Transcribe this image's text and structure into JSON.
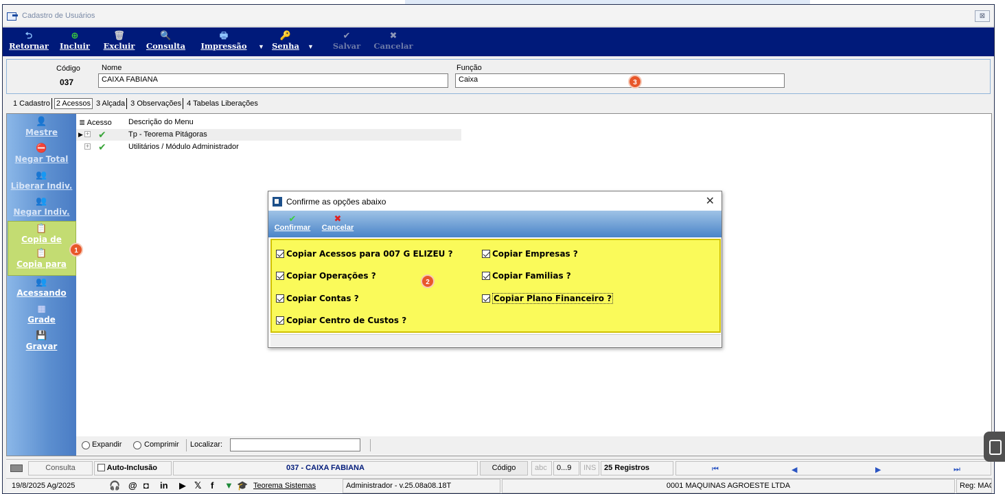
{
  "window": {
    "title": "Cadastro de Usuários",
    "close_glyph": "⊠"
  },
  "toolbar": {
    "items": [
      {
        "label": "Retornar",
        "icon": "return-icon",
        "glyph": "⮌",
        "color": "#8fc4ff"
      },
      {
        "label": "Incluir",
        "icon": "add-icon",
        "glyph": "⊕",
        "color": "#3bd13b"
      },
      {
        "label": "Excluir",
        "icon": "trash-icon",
        "glyph": "🗑",
        "color": "#d0d0d0"
      },
      {
        "label": "Consulta",
        "icon": "search-icon",
        "glyph": "🔍",
        "color": "#8fc4ff"
      },
      {
        "label": "Impressão",
        "icon": "printer-icon",
        "glyph": "🖶",
        "color": "#8fc4ff"
      },
      {
        "label": "Senha",
        "icon": "key-icon",
        "glyph": "🔑",
        "color": "#f5c542"
      },
      {
        "label": "Salvar",
        "icon": "check-icon",
        "glyph": "✔",
        "color": "#b8c2e0"
      },
      {
        "label": "Cancelar",
        "icon": "x-icon",
        "glyph": "✖",
        "color": "#b8c2e0"
      }
    ]
  },
  "header": {
    "codigo_label": "Código",
    "codigo_value": "037",
    "nome_label": "Nome",
    "nome_value": "CAIXA FABIANA",
    "funcao_label": "Função",
    "funcao_value": "Caixa"
  },
  "badges": {
    "b1": "1",
    "b2": "2",
    "b3": "3"
  },
  "tabs": [
    "1 Cadastro",
    "2 Acessos",
    "3 Alçada",
    "3 Observações",
    "4 Tabelas Liberações"
  ],
  "sidebar": [
    {
      "label": "Mestre",
      "icon": "user-icon",
      "glyph": "👤"
    },
    {
      "label": "Negar Total",
      "icon": "deny-all-icon",
      "glyph": "⛔"
    },
    {
      "label": "Liberar Indiv.",
      "icon": "allow-user-icon",
      "glyph": "👥"
    },
    {
      "label": "Negar Indiv.",
      "icon": "deny-user-icon",
      "glyph": "👥"
    },
    {
      "label": "Copia de",
      "icon": "copy-from-icon",
      "glyph": "📋"
    },
    {
      "label": "Copia para",
      "icon": "copy-to-icon",
      "glyph": "📋"
    },
    {
      "label": "Acessando",
      "icon": "users-icon",
      "glyph": "👥"
    },
    {
      "label": "Grade",
      "icon": "grid-icon",
      "glyph": "▦"
    },
    {
      "label": "Gravar",
      "icon": "save-icon",
      "glyph": "💾"
    }
  ],
  "tree": {
    "col_acesso": "Acesso",
    "col_descricao": "Descrição do Menu",
    "rows": [
      {
        "label": "Tp - Teorema Pitágoras"
      },
      {
        "label": "Utilitários / Módulo Administrador"
      }
    ]
  },
  "bottom_bar": {
    "expandir": "Expandir",
    "comprimir": "Comprimir",
    "localizar": "Localizar:"
  },
  "dialog": {
    "title": "Confirme as opções abaixo",
    "confirm": "Confirmar",
    "cancel": "Cancelar",
    "options_left": [
      "Copiar Acessos para 007 G ELIZEU ?",
      "Copiar Operações ?",
      "Copiar Contas ?",
      "Copiar Centro de Custos ?"
    ],
    "options_right": [
      "Copiar Empresas ?",
      "Copiar Familias ?",
      "Copiar Plano Financeiro ?"
    ]
  },
  "status1": {
    "consulta": "Consulta",
    "auto_inclusao": "Auto-Inclusão",
    "registro": "037 - CAIXA FABIANA",
    "codigo": "Código",
    "abc": "abc",
    "num": "0...9",
    "ins": "INS",
    "registros": "25 Registros"
  },
  "status2": {
    "date": "19/8/2025 Ag/2025",
    "link": "Teorema Sistemas",
    "user": "Administrador - v.25.08a08.18T",
    "empresa": "0001 MAQUINAS AGROESTE LTDA",
    "reg": "Reg: MAQU"
  }
}
